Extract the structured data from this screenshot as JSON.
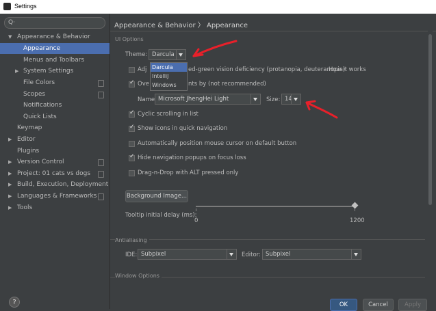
{
  "window": {
    "title": "Settings"
  },
  "sidebar": {
    "search_icon": "search-icon",
    "items": [
      {
        "label": "Appearance & Behavior",
        "arrow": "▼"
      },
      {
        "label": "Appearance"
      },
      {
        "label": "Menus and Toolbars"
      },
      {
        "label": "System Settings",
        "arrow": "▶"
      },
      {
        "label": "File Colors"
      },
      {
        "label": "Scopes"
      },
      {
        "label": "Notifications"
      },
      {
        "label": "Quick Lists"
      },
      {
        "label": "Keymap"
      },
      {
        "label": "Editor",
        "arrow": "▶"
      },
      {
        "label": "Plugins"
      },
      {
        "label": "Version Control",
        "arrow": "▶"
      },
      {
        "label": "Project: 01 cats vs dogs",
        "arrow": "▶"
      },
      {
        "label": "Build, Execution, Deployment",
        "arrow": "▶"
      },
      {
        "label": "Languages & Frameworks",
        "arrow": "▶"
      },
      {
        "label": "Tools",
        "arrow": "▶"
      }
    ]
  },
  "breadcrumb": {
    "part1": "Appearance & Behavior",
    "sep": "〉",
    "part2": "Appearance"
  },
  "ui_options": {
    "section": "UI Options",
    "theme_label": "Theme:",
    "theme_value": "Darcula",
    "theme_options": [
      "Darcula",
      "IntelliJ",
      "Windows"
    ],
    "adjust_prefix": "Adj",
    "adjust_suffix": "ed-green vision deficiency (protanopia, deuteranopia)",
    "how_it_works": "How it works",
    "override_prefix": "Ove",
    "override_suffix": "nts by (not recommended)",
    "name_label": "Name:",
    "font_value": "Microsoft JhengHei Light",
    "size_label": "Size:",
    "size_value": "14",
    "cyclic": "Cyclic scrolling in list",
    "show_icons": "Show icons in quick navigation",
    "auto_pos": "Automatically position mouse cursor on default button",
    "hide_nav": "Hide navigation popups on focus loss",
    "drag_drop": "Drag-n-Drop with ALT pressed only",
    "background_image": "Background Image...",
    "tooltip_label": "Tooltip initial delay (ms):",
    "slider_min": "0",
    "slider_max": "1200"
  },
  "antialiasing": {
    "section": "Antialiasing",
    "ide_label": "IDE:",
    "ide_value": "Subpixel",
    "editor_label": "Editor:",
    "editor_value": "Subpixel"
  },
  "window_options": {
    "section": "Window Options"
  },
  "buttons": {
    "help": "?",
    "ok": "OK",
    "cancel": "Cancel",
    "apply": "Apply"
  },
  "colors": {
    "selection": "#4b6eaf",
    "annotation": "#e8202a",
    "link": "#589df6"
  }
}
